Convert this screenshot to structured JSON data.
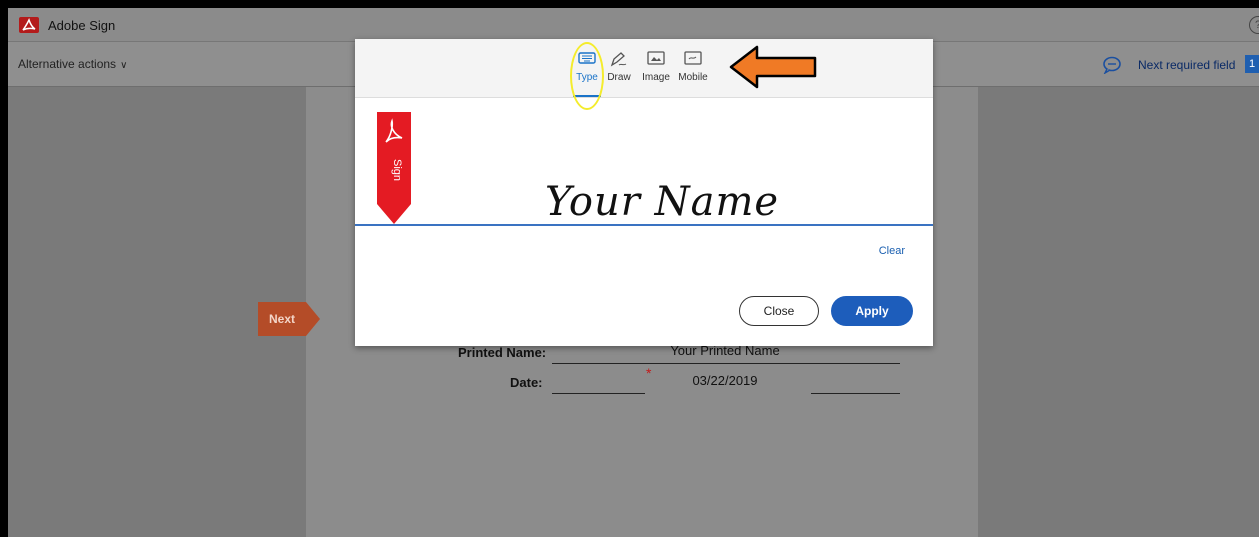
{
  "app": {
    "title": "Adobe Sign"
  },
  "actionbar": {
    "alt_actions": "Alternative actions",
    "next_required": "Next required field",
    "counter": "1"
  },
  "document": {
    "next_label": "Next",
    "printed_name_label": "Printed Name:",
    "printed_name_value": "Your Printed Name",
    "date_label": "Date:",
    "date_value": "03/22/2019"
  },
  "modal": {
    "tabs": [
      {
        "label": "Type",
        "icon": "keyboard-icon",
        "active": true
      },
      {
        "label": "Draw",
        "icon": "pen-icon",
        "active": false
      },
      {
        "label": "Image",
        "icon": "image-icon",
        "active": false
      },
      {
        "label": "Mobile",
        "icon": "mobile-icon",
        "active": false
      }
    ],
    "ribbon_text": "Sign",
    "signature_text": "Your Name",
    "clear_label": "Clear",
    "close_label": "Close",
    "apply_label": "Apply"
  },
  "colors": {
    "accent": "#1d5dbb",
    "highlight": "#f4ec2c",
    "arrow": "#f07a25",
    "ribbon": "#e41b23"
  }
}
